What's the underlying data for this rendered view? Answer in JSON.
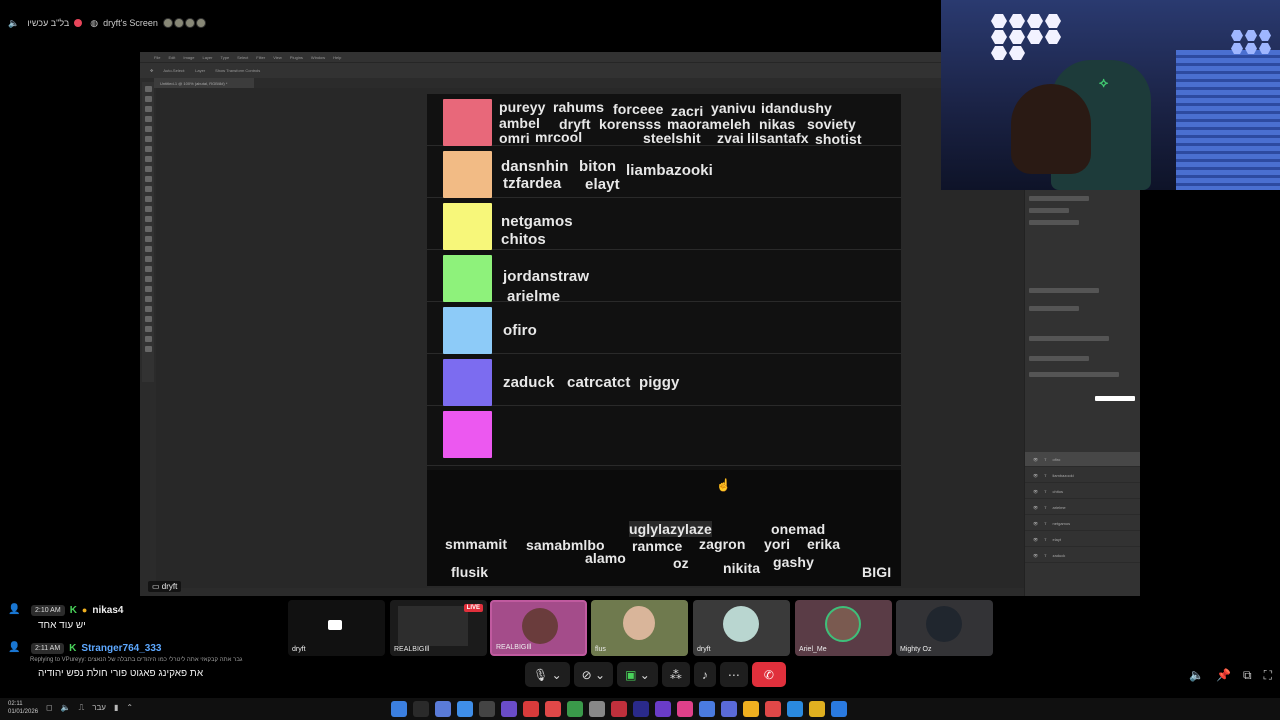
{
  "call": {
    "channel_label": "בל\"ב עכשיו",
    "screen_label": "dryft's Screen"
  },
  "share": {
    "presenter_label": "dryft",
    "ps_menu": [
      "File",
      "Edit",
      "Image",
      "Layer",
      "Type",
      "Select",
      "Filter",
      "View",
      "Plugins",
      "Window",
      "Help"
    ],
    "ps_tab": "Untitled-1 @ 100% (abutal, RGB/8#) *",
    "layers": [
      "ofiro",
      "liambazooki",
      "chitos",
      "arielme",
      "netgamos",
      "elayt",
      "zaduck"
    ]
  },
  "tier_list": {
    "rows": [
      {
        "color": "#e8687a",
        "names": [
          "pureyy",
          "rahums",
          "forceee",
          "zacri",
          "yanivu",
          "idandushy",
          "ambel",
          "dryft",
          "korensss",
          "maorameleh",
          "nikas",
          "soviety",
          "omri",
          "mrcool",
          "steelshit",
          "zvai",
          "lilsantafx",
          "shotist"
        ]
      },
      {
        "color": "#f2bb85",
        "names": [
          "dansnhin",
          "biton",
          "liambazooki",
          "tzfardea",
          "elayt"
        ]
      },
      {
        "color": "#f7f77a",
        "names": [
          "netgamos",
          "chitos"
        ]
      },
      {
        "color": "#8ef27b",
        "names": [
          "jordanstraw",
          "arielme"
        ]
      },
      {
        "color": "#8dcbf8",
        "names": [
          "ofiro"
        ]
      },
      {
        "color": "#7c6cf0",
        "names": [
          "zaduck",
          "catrcatct",
          "piggy"
        ]
      },
      {
        "color": "#ec58f0",
        "names": []
      }
    ],
    "pool": [
      "smmamit",
      "samabmlbo",
      "alamo",
      "uglylazylaze",
      "ranmce",
      "zagron",
      "oz",
      "onemad",
      "yori",
      "erika",
      "gashy",
      "nikita",
      "flusik",
      "BIGI"
    ]
  },
  "chat": [
    {
      "time": "2:10 AM",
      "user": "nikas4",
      "text": "יש עוד אחד"
    },
    {
      "time": "2:11 AM",
      "user": "Stranger764_333",
      "reply": "Replying to VPureyy: גבר אתה קבקאזי אתה ליטרלי כמו היהודים בתבלה של הנאצים",
      "text": "את פאקינג פאגוט פורי חולת נפש יהודיה"
    }
  ],
  "tiles": [
    {
      "label": "dryft",
      "live": false,
      "color": "#1a1a1a"
    },
    {
      "label": "REALBIGIll",
      "live": true,
      "color": "#1b1b1b"
    },
    {
      "label": "REALBIGIll",
      "live": false,
      "color": "#a44c8a"
    },
    {
      "label": "flus",
      "live": false,
      "color": "#6f7a4e"
    },
    {
      "label": "dryft",
      "live": false,
      "color": "#3a3a3a"
    },
    {
      "label": "Ariel_Me",
      "live": false,
      "color": "#5a3c46"
    },
    {
      "label": "Mighty Oz",
      "live": false,
      "color": "#333336"
    }
  ],
  "live_badge": "LIVE",
  "taskbar": {
    "time": "02:11",
    "date": "01/01/2026",
    "lang": "עבר"
  }
}
